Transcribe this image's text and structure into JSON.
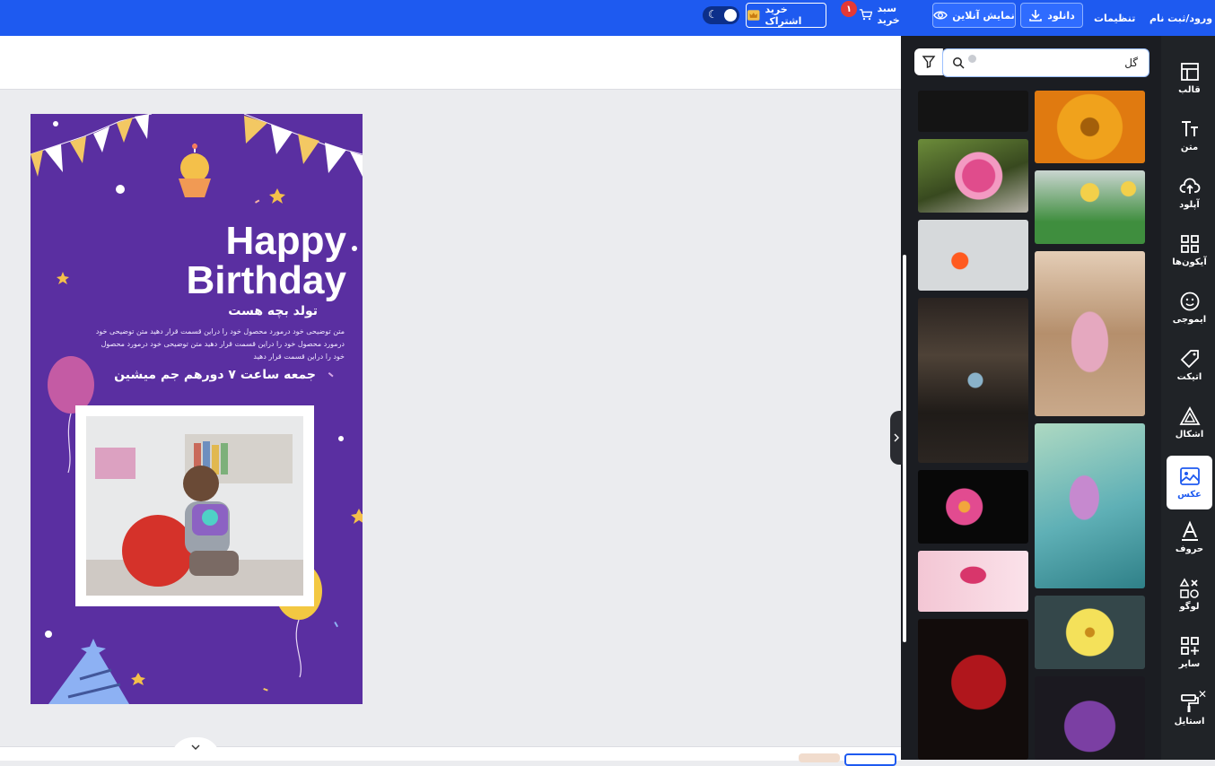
{
  "topbar": {
    "login": "ورود/ثبت نام",
    "settings": "تنظیمات",
    "download": "دانلود",
    "preview": "نمایش آنلاین",
    "cart": "سبد خرید",
    "cart_count": "۱",
    "subscribe": "خرید اشتراک"
  },
  "card": {
    "title_line1": "Happy",
    "title_line2": "Birthday",
    "subtitle": "تولد بچه هست",
    "desc_line1": "متن توضیحی خود درمورد محصول خود را دراین قسمت قرار دهید متن توضیحی خود",
    "desc_line2": "درمورد محصول خود را دراین قسمت قرار دهید متن توضیحی خود درمورد محصول",
    "desc_line3": "خود را دراین قسمت قرار دهید",
    "datetime": "جمعه ساعت ۷ دورهم جم میشین"
  },
  "search": {
    "value": "گل"
  },
  "sidebar": {
    "items": [
      {
        "label": "قالب",
        "icon": "template-icon"
      },
      {
        "label": "متن",
        "icon": "text-icon"
      },
      {
        "label": "آپلود",
        "icon": "upload-icon"
      },
      {
        "label": "آیکون‌ها",
        "icon": "grid-icon"
      },
      {
        "label": "ایموجی",
        "icon": "emoji-icon"
      },
      {
        "label": "اتیکت",
        "icon": "tag-icon"
      },
      {
        "label": "اشکال",
        "icon": "shapes-icon"
      },
      {
        "label": "عکس",
        "icon": "image-icon"
      },
      {
        "label": "حروف",
        "icon": "letter-icon"
      },
      {
        "label": "لوگو",
        "icon": "logo-icon"
      },
      {
        "label": "سایر",
        "icon": "more-icon"
      },
      {
        "label": "استایل",
        "icon": "style-icon"
      }
    ],
    "active": "عکس"
  },
  "colors": {
    "topbar": "#1e5af0",
    "panel": "#1b1d22",
    "card": "#5a2fa1"
  }
}
